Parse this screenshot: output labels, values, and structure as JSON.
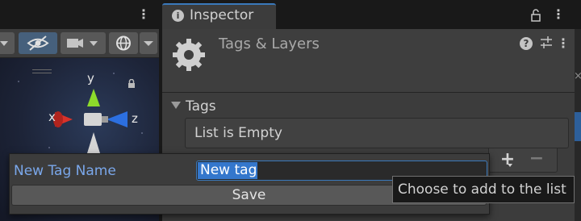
{
  "inspector": {
    "tab_label": "Inspector",
    "header_title": "Tags & Layers",
    "icons": [
      "info-icon",
      "lock-icon",
      "kebab-menu-icon",
      "gear-icon",
      "help-icon",
      "presets-icon"
    ]
  },
  "tags": {
    "foldout_label": "Tags",
    "empty_message": "List is Empty",
    "add_symbol": "+",
    "remove_symbol": "−"
  },
  "popup": {
    "label": "New Tag Name",
    "input_value": "New tag",
    "save_label": "Save"
  },
  "tooltip": {
    "text": "Choose to add to the list"
  },
  "scene": {
    "axis_labels": {
      "x": "x",
      "y": "y",
      "z": "z"
    },
    "icons": [
      "visibility-icon",
      "camera-icon",
      "gizmos-icon",
      "kebab-menu-icon"
    ]
  },
  "colors": {
    "accent": "#3a79bb",
    "label_blue": "#7aa7ea",
    "panel": "#3c3c3c",
    "axis_x": "#d8322a",
    "axis_y": "#8ddb2b",
    "axis_z": "#2c6fe0"
  }
}
